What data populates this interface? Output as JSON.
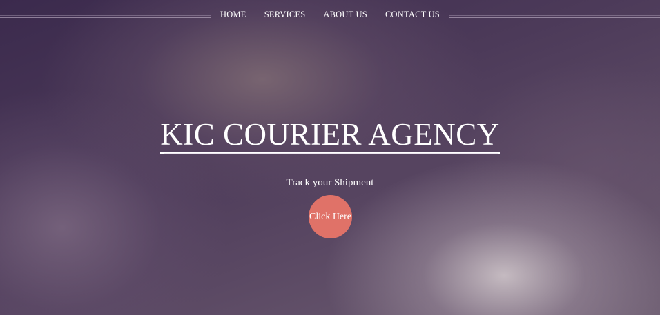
{
  "nav": {
    "items": [
      {
        "label": "HOME"
      },
      {
        "label": "SERVICES"
      },
      {
        "label": "ABOUT US"
      },
      {
        "label": "CONTACT US"
      }
    ]
  },
  "hero": {
    "title": "KIC COURIER AGENCY",
    "tagline": "Track your Shipment",
    "cta_label": "Click Here"
  },
  "colors": {
    "accent": "#e07268",
    "background_dark": "#3b2a4d",
    "text": "#ffffff"
  }
}
